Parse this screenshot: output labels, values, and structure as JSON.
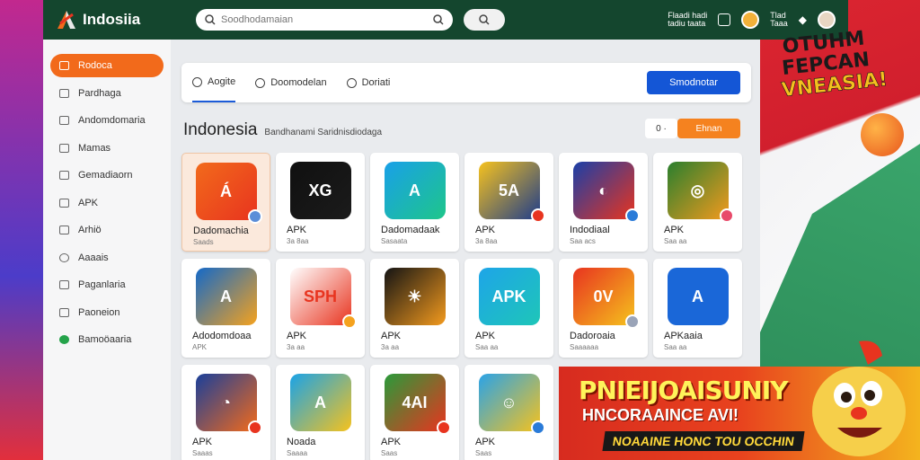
{
  "header": {
    "brand": "Indosiia",
    "search_placeholder": "Soodhodamaian",
    "links": [
      {
        "line1": "Flaadi hadi",
        "line2": "tadiu taata"
      },
      {
        "line1": "Tlad",
        "line2": "Taaa"
      }
    ]
  },
  "sidebar": {
    "items": [
      {
        "label": "Rodoca",
        "active": true,
        "icon": "home-icon"
      },
      {
        "label": "Pardhaga",
        "icon": "grid-icon"
      },
      {
        "label": "Andomdomaria",
        "icon": "apps-icon"
      },
      {
        "label": "Mamas",
        "icon": "chart-icon"
      },
      {
        "label": "Gemadiaorn",
        "icon": "game-icon"
      },
      {
        "label": "APK",
        "icon": "download-icon"
      },
      {
        "label": "Arhiö",
        "icon": "archive-icon"
      },
      {
        "label": "Aaaais",
        "icon": "info-icon"
      },
      {
        "label": "Paganlaria",
        "icon": "page-icon"
      },
      {
        "label": "Paoneion",
        "icon": "phone-icon"
      },
      {
        "label": "Bamoöaaria",
        "icon": "whatsapp-icon"
      }
    ]
  },
  "tabs": [
    {
      "label": "Aogite",
      "active": true
    },
    {
      "label": "Doomodelan"
    },
    {
      "label": "Doriati"
    }
  ],
  "primary_button": "Smodnotar",
  "section": {
    "title": "Indonesia",
    "subtitle": "Bandhanami Saridnisdiodaga",
    "filter": "0 ·",
    "action": "Ehnan"
  },
  "apps": [
    {
      "name": "Dadomachia",
      "meta": "Saads",
      "icon_text": "Á",
      "color1": "#f26a1b",
      "color2": "#e8341f",
      "badge": "#5b8ed8",
      "highlight": true
    },
    {
      "name": "APK",
      "meta": "3a 8aa",
      "icon_text": "XG",
      "color1": "#101010",
      "color2": "#1b1b1b",
      "badge": ""
    },
    {
      "name": "Dadomadaak",
      "meta": "Sasaata",
      "icon_text": "A",
      "color1": "#19a0e8",
      "color2": "#1ec68a",
      "badge": ""
    },
    {
      "name": "APK",
      "meta": "3a 8aa",
      "icon_text": "5A",
      "color1": "#f6c21e",
      "color2": "#1f3d8a",
      "badge": "#e8341f"
    },
    {
      "name": "Indodiaal",
      "meta": "Saa acs",
      "icon_text": "◐",
      "color1": "#1a3fa8",
      "color2": "#e8341f",
      "badge": "#2a7bd8"
    },
    {
      "name": "APK",
      "meta": "Saa aa",
      "icon_text": "◎",
      "color1": "#2a7f2e",
      "color2": "#f29a1e",
      "badge": "#e84a6a"
    },
    {
      "name": "Adodomdoaa",
      "meta": "APK",
      "icon_text": "A",
      "color1": "#1469c8",
      "color2": "#f5a21e",
      "badge": ""
    },
    {
      "name": "APK",
      "meta": "3a aa",
      "icon_text": "SPH",
      "color1": "#ffffff",
      "color2": "#e8341f",
      "badge": "#f5a21e"
    },
    {
      "name": "APK",
      "meta": "3a aa",
      "icon_text": "☀",
      "color1": "#141414",
      "color2": "#f39a1e",
      "badge": ""
    },
    {
      "name": "APK",
      "meta": "Saa aa",
      "icon_text": "APK",
      "color1": "#1ea5e8",
      "color2": "#1ec6b8",
      "badge": ""
    },
    {
      "name": "Dadoroaia",
      "meta": "Saaaaaa",
      "icon_text": "0V",
      "color1": "#e8341f",
      "color2": "#f5c21e",
      "badge": "#9aa4b8"
    },
    {
      "name": "APKaaia",
      "meta": "Saa aa",
      "icon_text": "A",
      "color1": "#1a67d8",
      "color2": "#1a67d8",
      "badge": ""
    },
    {
      "name": "APK",
      "meta": "Saaas",
      "icon_text": "◔",
      "color1": "#1a3f9a",
      "color2": "#f26a1b",
      "badge": "#e8341f"
    },
    {
      "name": "Noada",
      "meta": "Saaaa",
      "icon_text": "A",
      "color1": "#1aa3e8",
      "color2": "#f5c21e",
      "badge": ""
    },
    {
      "name": "APK",
      "meta": "Saas",
      "icon_text": "4AI",
      "color1": "#2a9a3a",
      "color2": "#e8341f",
      "badge": "#e8341f"
    },
    {
      "name": "APK",
      "meta": "Saas",
      "icon_text": "☺",
      "color1": "#2aa3e8",
      "color2": "#f5c21e",
      "badge": "#2a7bd8"
    }
  ],
  "promo": {
    "line1": "PNIEIJOAISUNIY",
    "line2": "HNCORAAINCE AVI!",
    "line3": "NOAAINE HONC TOU OCCHIN"
  },
  "sticker": {
    "line1": "OTUHM",
    "line2": "FEPCAN",
    "line3": "VNEASIA!"
  },
  "colors": {
    "topbar": "#14462e",
    "accent_orange": "#f26a1b",
    "primary_blue": "#1456d6"
  }
}
